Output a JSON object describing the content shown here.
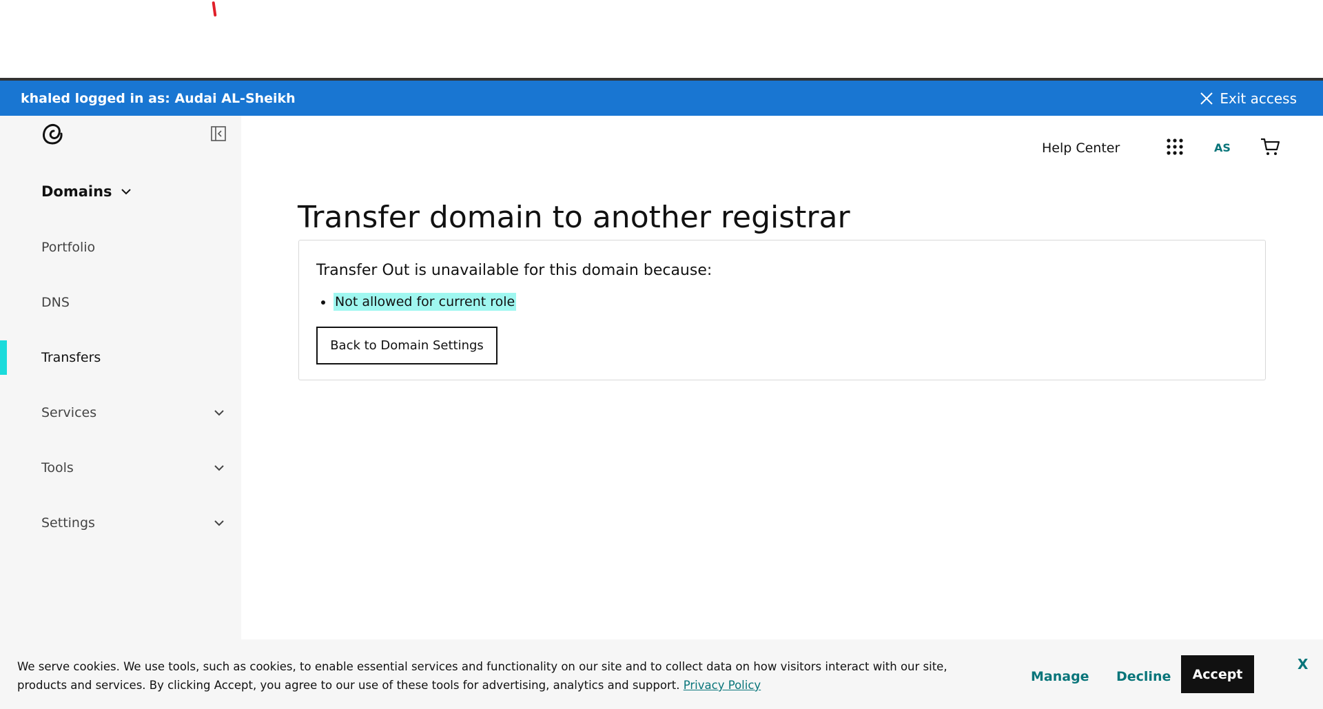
{
  "impersonation": {
    "text": "khaled logged in as: Audai AL-Sheikh",
    "exit_label": "Exit access",
    "bg_color": "#1976d2"
  },
  "sidebar": {
    "section_title": "Domains",
    "items": [
      {
        "label": "Portfolio",
        "active": false,
        "expandable": false
      },
      {
        "label": "DNS",
        "active": false,
        "expandable": false
      },
      {
        "label": "Transfers",
        "active": true,
        "expandable": false
      },
      {
        "label": "Services",
        "active": false,
        "expandable": true
      },
      {
        "label": "Tools",
        "active": false,
        "expandable": true
      },
      {
        "label": "Settings",
        "active": false,
        "expandable": true
      }
    ],
    "active_color": "#1bdbdb"
  },
  "header": {
    "help_center": "Help Center",
    "avatar_initials": "AS",
    "icons": [
      "apps-grid-icon",
      "cart-icon",
      "logo-icon",
      "collapse-sidebar-icon"
    ]
  },
  "main": {
    "title": "Transfer domain to another registrar",
    "reason_heading": "Transfer Out is unavailable for this domain because:",
    "reasons": [
      "Not allowed for current role"
    ],
    "back_button": "Back to Domain Settings"
  },
  "cookie_banner": {
    "text": "We serve cookies. We use tools, such as cookies, to enable essential services and functionality on our site and to collect data on how visitors interact with our site, products and services. By clicking Accept, you agree to our use of these tools for advertising, analytics and support.",
    "privacy_link": "Privacy Policy",
    "manage": "Manage",
    "decline": "Decline",
    "accept": "Accept",
    "close": "X"
  }
}
